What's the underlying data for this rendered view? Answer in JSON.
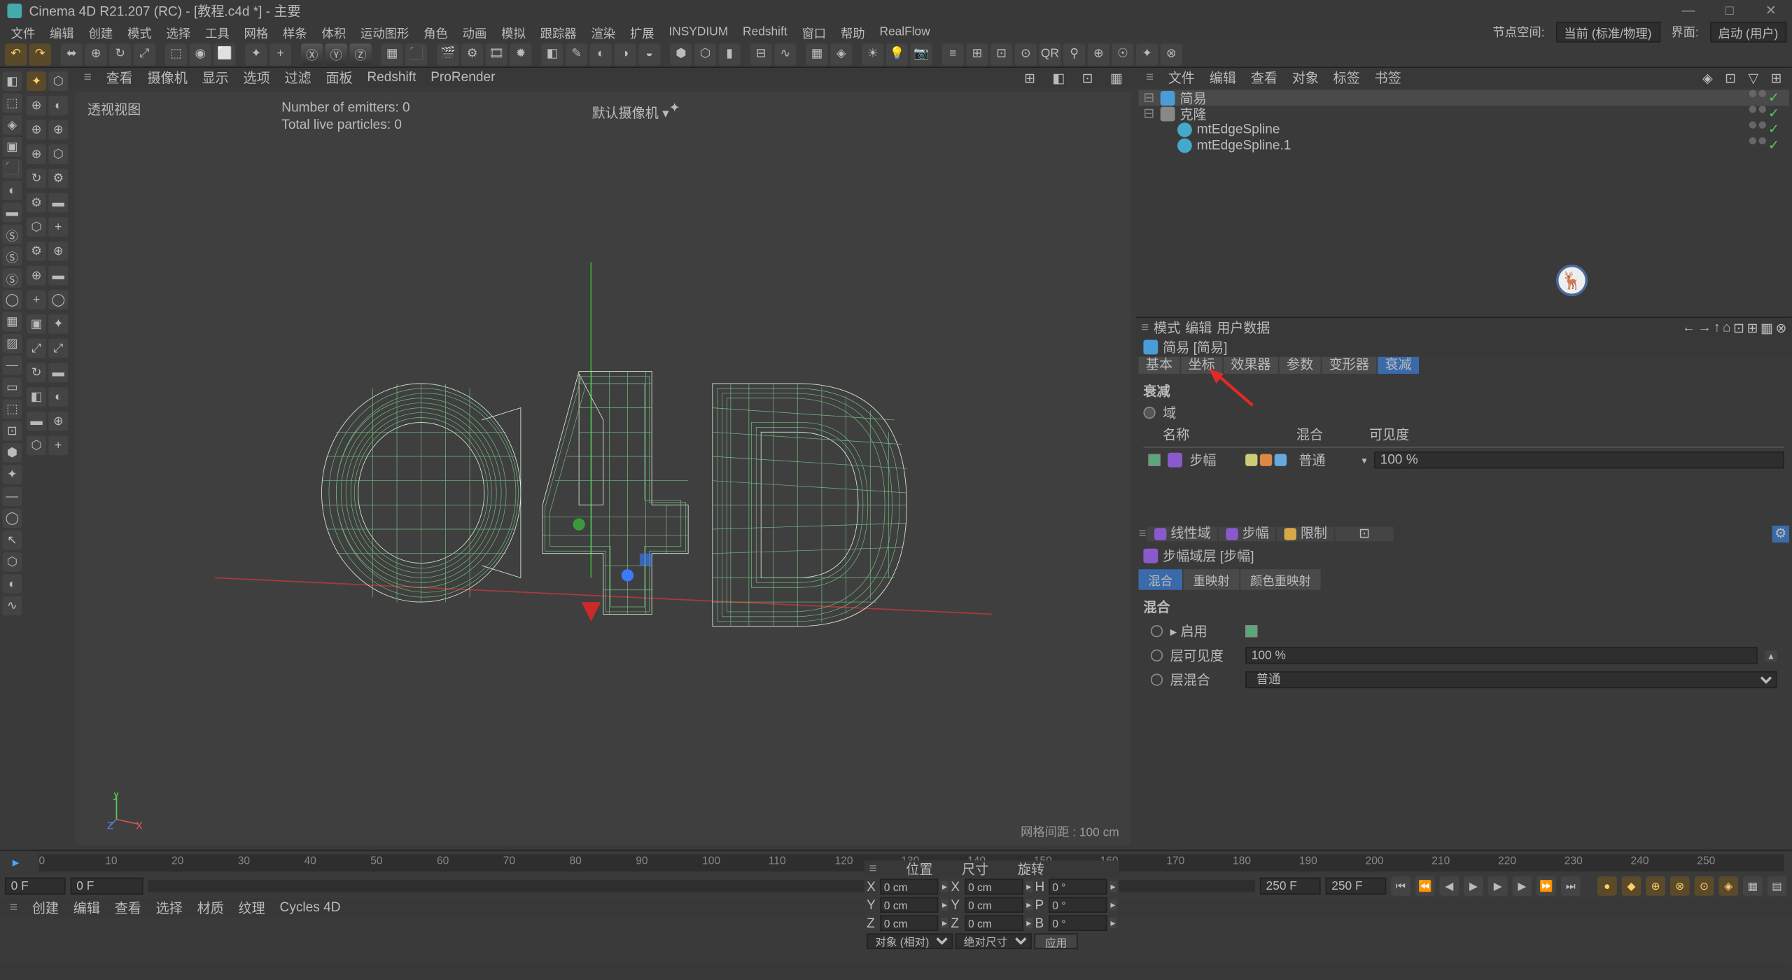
{
  "title": "Cinema 4D R21.207 (RC) - [教程.c4d *] - 主要",
  "menus": [
    "文件",
    "编辑",
    "创建",
    "模式",
    "选择",
    "工具",
    "网格",
    "样条",
    "体积",
    "运动图形",
    "角色",
    "动画",
    "模拟",
    "跟踪器",
    "渲染",
    "扩展",
    "INSYDIUM",
    "Redshift",
    "窗口",
    "帮助",
    "RealFlow"
  ],
  "menuRight": {
    "nodespace_lbl": "节点空间:",
    "nodespace_val": "当前 (标准/物理)",
    "layout_lbl": "界面:",
    "layout_val": "启动 (用户)"
  },
  "vpmenu": [
    "查看",
    "摄像机",
    "显示",
    "选项",
    "过滤",
    "面板",
    "Redshift",
    "ProRender"
  ],
  "vp": {
    "title": "透视视图",
    "camera": "默认摄像机",
    "stat1": "Number of emitters: 0",
    "stat2": "Total live particles: 0",
    "grid": "网格间距 : 100 cm"
  },
  "objmgr": {
    "menus": [
      "文件",
      "编辑",
      "查看",
      "对象",
      "标签",
      "书签"
    ],
    "items": [
      {
        "name": "简易",
        "type": "simple",
        "sel": true
      },
      {
        "name": "克隆",
        "type": "null"
      },
      {
        "name": "mtEdgeSpline",
        "type": "spline",
        "indent": 1
      },
      {
        "name": "mtEdgeSpline.1",
        "type": "spline",
        "indent": 1
      }
    ]
  },
  "attr": {
    "menus": [
      "模式",
      "编辑",
      "用户数据"
    ],
    "objname": "简易 [简易]",
    "tabs": [
      "基本",
      "坐标",
      "效果器",
      "参数",
      "变形器",
      "衰减"
    ],
    "activeTab": 5,
    "section": "衰减",
    "radioLbl": "域",
    "cols": {
      "name": "名称",
      "blend": "混合",
      "vis": "可见度"
    },
    "field": {
      "name": "步幅",
      "blend": "普通",
      "vis": "100 %"
    },
    "subtabs": [
      "线性域",
      "步幅",
      "限制"
    ],
    "layerTitle": "步幅域层 [步幅]",
    "subtabs2": [
      "混合",
      "重映射",
      "颜色重映射"
    ],
    "activeSub2": 0,
    "sectionBlend": "混合",
    "enable": {
      "lbl": "▸ 启用",
      "val": true
    },
    "layervis": {
      "lbl": "层可见度",
      "val": "100 %"
    },
    "layerblend": {
      "lbl": "层混合",
      "val": "普通"
    }
  },
  "timeline": {
    "frames": [
      0,
      10,
      20,
      30,
      40,
      50,
      60,
      70,
      80,
      90,
      100,
      110,
      120,
      130,
      140,
      150,
      160,
      170,
      180,
      190,
      200,
      210,
      220,
      230,
      240,
      250
    ],
    "start": "0 F",
    "end": "250 F",
    "cur": "0 F",
    "rangeEnd": "250 F"
  },
  "bottom": [
    "创建",
    "编辑",
    "查看",
    "选择",
    "材质",
    "纹理",
    "Cycles 4D"
  ],
  "coord": {
    "hdrs": [
      "位置",
      "尺寸",
      "旋转"
    ],
    "rows": [
      {
        "a": "X",
        "v1": "0 cm",
        "b": "X",
        "v2": "0 cm",
        "c": "H",
        "v3": "0 °"
      },
      {
        "a": "Y",
        "v1": "0 cm",
        "b": "Y",
        "v2": "0 cm",
        "c": "P",
        "v3": "0 °"
      },
      {
        "a": "Z",
        "v1": "0 cm",
        "b": "Z",
        "v2": "0 cm",
        "c": "B",
        "v3": "0 °"
      }
    ],
    "sel1": "对象 (相对)",
    "sel2": "绝对尺寸",
    "apply": "应用"
  }
}
